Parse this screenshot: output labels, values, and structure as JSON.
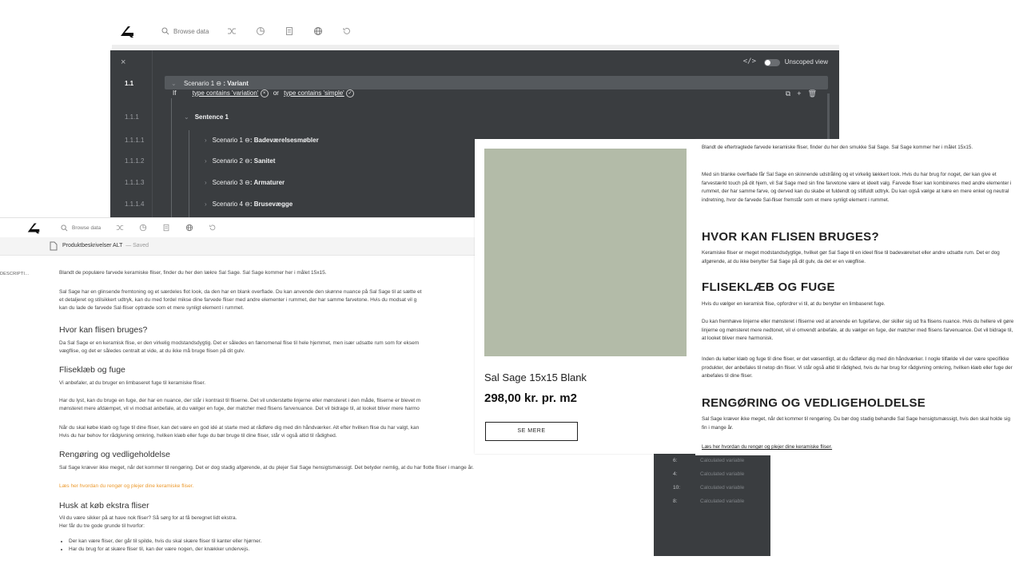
{
  "app": {
    "toolbar": {
      "search_label": "Browse data",
      "icons": [
        "logo-icon",
        "search-icon",
        "shuffle-icon",
        "analytics-icon",
        "document-icon",
        "globe-icon",
        "history-icon"
      ]
    }
  },
  "scenario_editor": {
    "close": "×",
    "code_icon": "</>",
    "unscoped_view": "Unscoped view",
    "rows": [
      {
        "num": "1.1",
        "prefix": "Scenario 1",
        "name": "Variant"
      },
      {
        "num": "1.1.1",
        "label": "Sentence 1"
      },
      {
        "num": "1.1.1.1",
        "prefix": "Scenario 1",
        "name": "Badeværelsesmøbler"
      },
      {
        "num": "1.1.1.2",
        "prefix": "Scenario 2",
        "name": "Sanitet"
      },
      {
        "num": "1.1.1.3",
        "prefix": "Scenario 3",
        "name": "Armaturer"
      },
      {
        "num": "1.1.1.4",
        "prefix": "Scenario 4",
        "name": "Brusevægge"
      }
    ],
    "condition": {
      "if": "If",
      "cond1": "type contains 'variation'",
      "or": "or",
      "cond2": "type contains 'simple'"
    }
  },
  "editor": {
    "tab_name": "Produktbeskrivelser ALT",
    "tab_status": "— Saved",
    "side_label": "DESCRIPTI...",
    "p1": "Blandt de populære farvede keramiske fliser, finder du her den lækre Sal Sage. Sal Sage kommer her i målet 15x15.",
    "p2a": "Sal Sage har en glinsende fremtoning og et særdeles flot look, da den har en blank overflade. Du kan anvende den skønne nuance på Sal Sage til at sætte et",
    "p2b": "et detaljeret og stilsikkert udtryk, kan du med fordel mikse dine farvede fliser med andre elementer i rummet, der har samme farvetone. Hvis du modsat vil g",
    "p2c": "kan du lade de farvede Sal-fliser optræde som et mere synligt element i rummet.",
    "h1": "Hvor kan flisen bruges?",
    "p3a": "Da Sal Sage er en keramisk flise, er den virkelig modstandsdygtig. Det er således en fænomenal flise til hele hjemmet, men især udsatte rum som for eksem",
    "p3b": "vægflise, og det er således centralt at vide, at du ikke må bruge flisen på dit gulv.",
    "h2": "Fliseklæb og fuge",
    "p4": "Vi anbefaler, at du bruger en limbaseret fuge til keramiske fliser.",
    "p5a": "Har du lyst, kan du bruge en fuge, der har en nuance, der står i kontrast til fliserne. Det vil understøtte linjerne eller mønsteret i den måde, fliserne er blevet m",
    "p5b": "mønsteret mere afdæmpet, vil vi modsat anbefale, at du vælger en fuge, der matcher med flisens farvenuance. Det vil bidrage til, at looket bliver mere harmo",
    "p6a": "Når du skal købe klæb og fuge til dine fliser, kan det være en god idé at starte med at rådføre dig med din håndværker. Alt efter hvilken flise du har valgt, kan",
    "p6b": "Hvis du har behov for rådgivning omkring, hvilken klæb eller fuge du bør bruge til dine fliser, står vi også altid til rådighed.",
    "h3": "Rengøring og vedligeholdelse",
    "p7": "Sal Sage kræver ikke meget, når det kommer til rengøring. Det er dog stadig afgørende, at du plejer Sal Sage hensigtsmæssigt. Det betyder nemlig, at du har flotte fliser i mange år.",
    "link": "Læs her hvordan du rengør og plejer dine keramiske fliser.",
    "h4": "Husk at køb ekstra fliser",
    "p8a": "Vil du være sikker på at have nok fliser? Så sørg for at få beregnet lidt ekstra.",
    "p8b": "Her får du tre gode grunde til hvorfor:",
    "li1": "Der kan være fliser, der går til spilde, hvis du skal skære fliser til kanter eller hjørner.",
    "li2": "Har du brug for at skære fliser til, kan der være nogen, der knækker undervejs."
  },
  "product": {
    "name": "Sal Sage 15x15 Blank",
    "price": "298,00 kr. pr. m2",
    "button": "SE MERE",
    "swatch_color": "#b3bba8"
  },
  "article": {
    "p1": "Blandt de eftertragtede farvede keramiske fliser, finder du her den smukke Sal Sage. Sal Sage kommer her i målet 15x15.",
    "p2": "Med sin blanke overflade får Sal Sage en skinnende udstråling og et virkelig lækkert look. Hvis du har brug for noget, der kan give et farvestærkt touch på dit hjem, vil Sal Sage med sin fine farvetone være et ideelt valg. Farvede fliser kan kombineres med andre elementer i rummet, der har samme farve, og derved kan du skabe et fuldendt og stilfuldt udtryk. Du kan også vælge at køre en mere enkel og neutral indretning, hvor de farvede Sal-fliser fremstår som et mere synligt element i rummet.",
    "h1": "HVOR KAN FLISEN BRUGES?",
    "p3": "Keramiske fliser er meget modstandsdygtige, hvilket gør Sal Sage til en ideel flise til badeværelset eller andre udsatte rum. Det er dog afgørende, at du ikke benytter Sal Sage på dit gulv, da det er en vægflise.",
    "h2": "FLISEKLÆB OG FUGE",
    "p4": "Hvis du vælger en keramisk flise, opfordrer vi til, at du benytter en limbaseret fuge.",
    "p5": "Du kan fremhæve linjerne eller mønsteret i fliserne ved at anvende en fugefarve, der skiller sig ud fra flisens nuance. Hvis du hellere vil gøre linjerne og mønsteret mere nedtonet, vil vi omvendt anbefale, at du vælger en fuge, der matcher med flisens farvenuance. Det vil bidrage til, at looket bliver mere harmonisk.",
    "p6": "Inden du køber klæb og fuge til dine fliser, er det væsentligt, at du rådfører dig med din håndværker. I nogle tilfælde vil der være specifikke produkter, der anbefales til netop din fliser. Vi står også altid til rådighed, hvis du har brug for rådgivning omkring, hvilken klæb eller fuge der anbefales til dine fliser.",
    "h3": "RENGØRING OG VEDLIGEHOLDELSE",
    "p7": "Sal Sage kræver ikke meget, når det kommer til rengøring. Du bør dog stadig behandle Sal Sage hensigtsmæssigt, hvis den skal holde sig fin i mange år.",
    "link": "Læs her hvordan du rengør og plejer dine keramiske fliser."
  },
  "variables": [
    {
      "num": "6:",
      "label": "Calculated variable"
    },
    {
      "num": "4:",
      "label": "Calculated variable"
    },
    {
      "num": "10:",
      "label": "Calculated variable"
    },
    {
      "num": "8:",
      "label": "Calculated variable"
    }
  ]
}
